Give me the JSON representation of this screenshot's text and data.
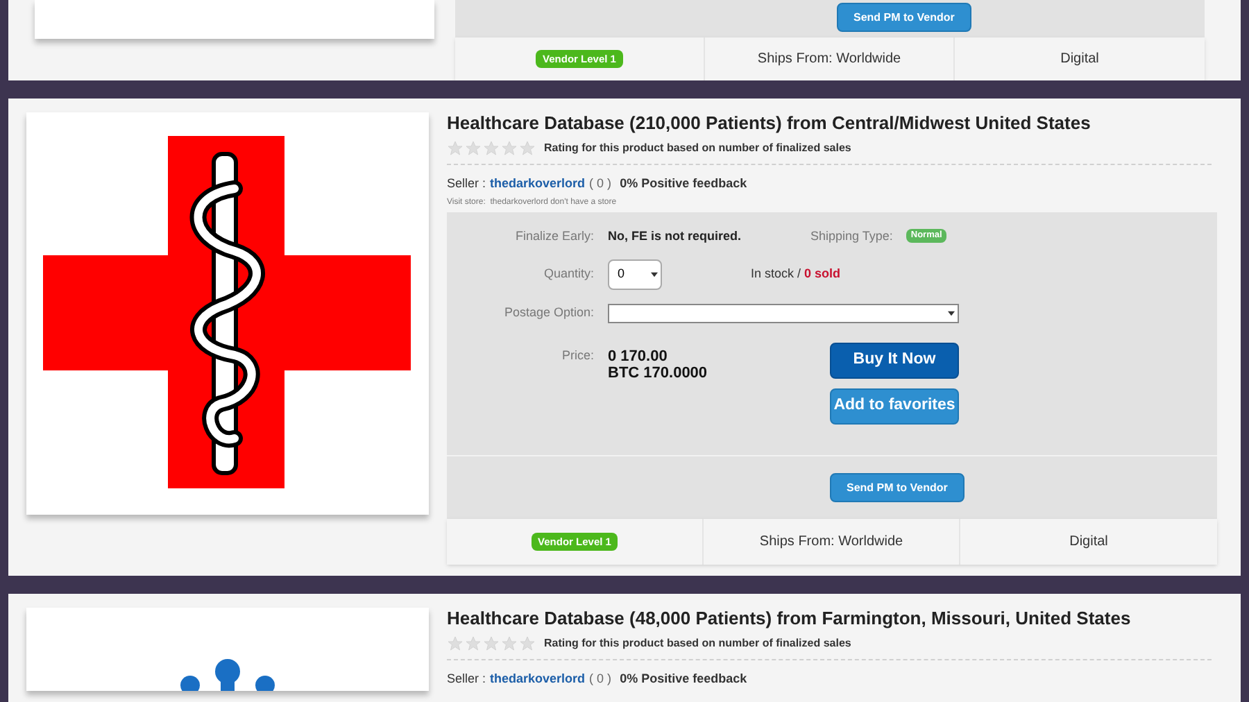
{
  "listings": [
    {
      "kind": "tail",
      "send_pm": "Send PM to Vendor",
      "vendor_level": "Vendor Level 1",
      "ships_from": "Ships From: Worldwide",
      "delivery": "Digital"
    },
    {
      "kind": "full",
      "title": "Healthcare Database (210,000 Patients) from Central/Midwest United States",
      "stars": 0,
      "rating_note": "Rating for this product based on number of finalized sales",
      "seller_label": "Seller :",
      "seller": "thedarkoverlord",
      "seller_count": "( 0 )",
      "feedback": "0% Positive feedback",
      "visit_store": "Visit store:  thedarkoverlord don't have a store",
      "finalize_label": "Finalize Early:",
      "finalize_value": "No, FE is not required.",
      "shipping_label": "Shipping Type:",
      "shipping_value": "Normal",
      "quantity_label": "Quantity:",
      "quantity": "0",
      "stock": "In stock / ",
      "sold": "0 sold",
      "postage_label": "Postage Option:",
      "price_label": "Price:",
      "price": "0 170.00",
      "price_btc": "BTC 170.0000",
      "buy": "Buy It Now",
      "favorite": "Add to favorites",
      "send_pm": "Send PM to Vendor",
      "vendor_level": "Vendor Level 1",
      "ships_from": "Ships From: Worldwide",
      "delivery": "Digital"
    },
    {
      "kind": "head",
      "title": "Healthcare Database (48,000 Patients) from Farmington, Missouri, United States",
      "stars": 0,
      "rating_note": "Rating for this product based on number of finalized sales",
      "seller_label": "Seller :",
      "seller": "thedarkoverlord",
      "seller_count": "( 0 )",
      "feedback": "0% Positive feedback"
    }
  ]
}
